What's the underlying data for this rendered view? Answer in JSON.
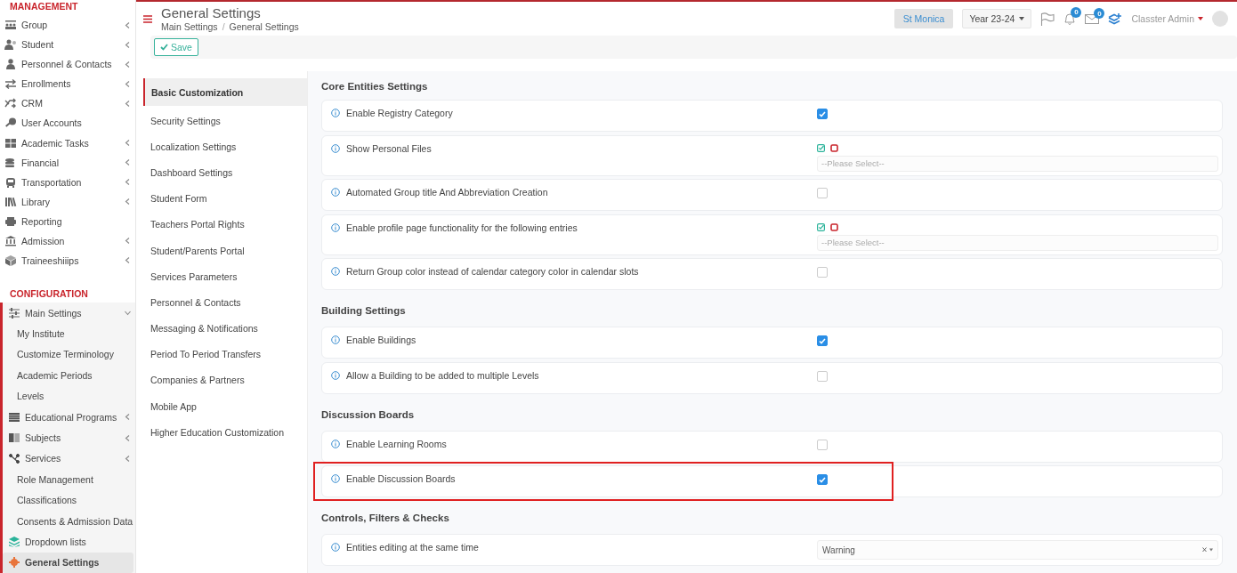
{
  "sidebar": {
    "sections": [
      {
        "title": "MANAGEMENT",
        "items": [
          {
            "label": "Group",
            "expanded": false
          },
          {
            "label": "Student",
            "expanded": false
          },
          {
            "label": "Personnel & Contacts",
            "expanded": false
          },
          {
            "label": "Enrollments",
            "expanded": false
          },
          {
            "label": "CRM",
            "expanded": false
          },
          {
            "label": "User Accounts"
          },
          {
            "label": "Academic Tasks",
            "expanded": false
          },
          {
            "label": "Financial",
            "expanded": false
          },
          {
            "label": "Transportation",
            "expanded": false
          },
          {
            "label": "Library",
            "expanded": false
          },
          {
            "label": "Reporting"
          },
          {
            "label": "Admission",
            "expanded": false
          },
          {
            "label": "Traineeshiiips",
            "expanded": false
          }
        ]
      },
      {
        "title": "CONFIGURATION",
        "items": [
          {
            "label": "Main Settings",
            "expanded": true,
            "children": [
              {
                "label": "My Institute",
                "selected": false
              },
              {
                "label": "Customize Terminology",
                "selected": false
              },
              {
                "label": "Academic Periods",
                "selected": false
              },
              {
                "label": "Levels",
                "selected": false
              },
              {
                "label": "Educational Programs",
                "expanded": false,
                "selected": false
              },
              {
                "label": "Subjects",
                "expanded": false,
                "selected": false
              },
              {
                "label": "Services",
                "expanded": false,
                "selected": false
              },
              {
                "label": "Role Management",
                "selected": false
              },
              {
                "label": "Classifications",
                "selected": false
              },
              {
                "label": "Consents & Admission Data",
                "selected": false
              },
              {
                "label": "Dropdown lists",
                "selected": false
              },
              {
                "label": "General Settings",
                "selected": true
              }
            ]
          }
        ]
      }
    ]
  },
  "header": {
    "title": "General Settings",
    "breadcrumb": [
      "Main Settings",
      "General Settings"
    ],
    "separator": "/",
    "school": "St Monica",
    "year": "Year 23-24",
    "notifications": "0",
    "messages": "0",
    "user": "Classter Admin"
  },
  "toolbar": {
    "save": "Save"
  },
  "settings_nav": [
    {
      "label": "Basic Customization",
      "selected": true
    },
    {
      "label": "Security Settings",
      "selected": false
    },
    {
      "label": "Localization Settings",
      "selected": false
    },
    {
      "label": "Dashboard Settings",
      "selected": false
    },
    {
      "label": "Student Form",
      "selected": false
    },
    {
      "label": "Teachers Portal Rights",
      "selected": false
    },
    {
      "label": "Student/Parents Portal",
      "selected": false
    },
    {
      "label": "Services Parameters",
      "selected": false
    },
    {
      "label": "Personnel & Contacts",
      "selected": false
    },
    {
      "label": "Messaging & Notifications",
      "selected": false
    },
    {
      "label": "Period To Period Transfers",
      "selected": false
    },
    {
      "label": "Companies & Partners",
      "selected": false
    },
    {
      "label": "Mobile App",
      "selected": false
    },
    {
      "label": "Higher Education Customization",
      "selected": false
    }
  ],
  "sections": [
    {
      "title": "Core Entities Settings",
      "rows": [
        {
          "kind": "checkbox",
          "label": "Enable Registry Category",
          "checked": true,
          "highlighted": false
        },
        {
          "kind": "multiselect",
          "label": "Show Personal Files",
          "placeholder": "--Please Select--",
          "highlighted": false
        },
        {
          "kind": "checkbox",
          "label": "Automated Group title And Abbreviation Creation",
          "checked": false,
          "highlighted": false
        },
        {
          "kind": "multiselect",
          "label": "Enable profile page functionality for the following entries",
          "placeholder": "--Please Select--",
          "highlighted": false
        },
        {
          "kind": "checkbox",
          "label": "Return Group color instead of calendar category color in calendar slots",
          "checked": false,
          "highlighted": false
        }
      ]
    },
    {
      "title": "Building Settings",
      "rows": [
        {
          "kind": "checkbox",
          "label": "Enable Buildings",
          "checked": true,
          "highlighted": false
        },
        {
          "kind": "checkbox",
          "label": "Allow a Building to be added to multiple Levels",
          "checked": false,
          "highlighted": false
        }
      ]
    },
    {
      "title": "Discussion Boards",
      "rows": [
        {
          "kind": "checkbox",
          "label": "Enable Learning Rooms",
          "checked": false,
          "highlighted": false
        },
        {
          "kind": "checkbox",
          "label": "Enable Discussion Boards",
          "checked": true,
          "highlighted": true
        }
      ]
    },
    {
      "title": "Controls, Filters & Checks",
      "rows": [
        {
          "kind": "select",
          "label": "Entities editing at the same time",
          "value": "Warning",
          "highlighted": false
        }
      ]
    }
  ]
}
